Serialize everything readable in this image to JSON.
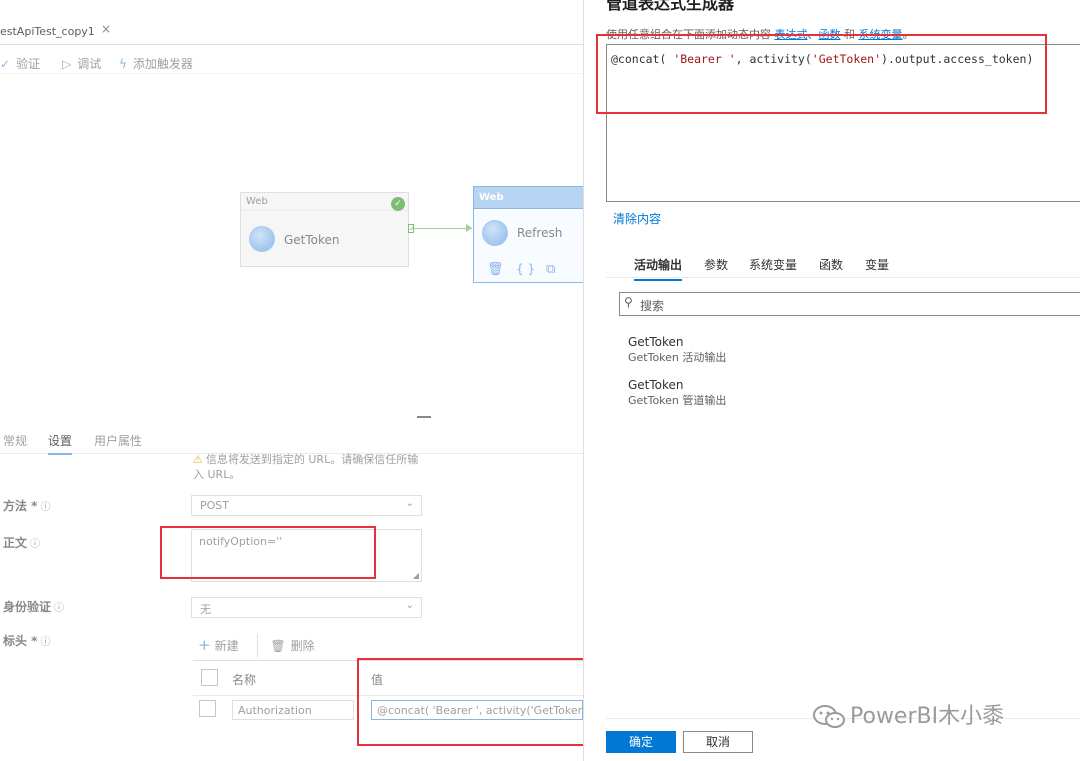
{
  "tab": {
    "title": "estApiTest_copy1",
    "close": "×"
  },
  "toolbar": {
    "validate": "验证",
    "debug": "调试",
    "add_trigger": "添加触发器"
  },
  "nodes": [
    {
      "type": "Web",
      "label": "GetToken",
      "status": "success"
    },
    {
      "type": "Web",
      "label": "Refresh",
      "status": "selected"
    }
  ],
  "settings": {
    "tabs": [
      "常规",
      "设置",
      "用户属性"
    ],
    "selected_tab": "设置",
    "warning": "信息将发送到指定的 URL。请确保信任所输入 URL。",
    "method_label": "方法 *",
    "method_value": "POST",
    "body_label": "正文",
    "body_value": "notifyOption=''",
    "auth_label": "身份验证",
    "auth_value": "无",
    "headers_label": "标头 *",
    "new_label": "新建",
    "delete_label": "删除",
    "col_name": "名称",
    "col_value": "值",
    "header_name_value": "Authorization",
    "header_value_value": "@concat( 'Bearer ', activity('GetToken')...."
  },
  "panel": {
    "title": "管道表达式生成器",
    "desc_prefix": "使用任意组合在下面添加动态内容",
    "desc_link1": "表达式",
    "desc_sep": "、",
    "desc_link2": "函数",
    "desc_and": " 和 ",
    "desc_link3": "系统变量",
    "desc_end": "。",
    "expression_parts": {
      "p1": "@concat( ",
      "p2": "'Bearer '",
      "p3": ", activity(",
      "p4": "'GetToken'",
      "p5": ").output.access_token)"
    },
    "clear": "清除内容",
    "tabs": [
      "活动输出",
      "参数",
      "系统变量",
      "函数",
      "变量"
    ],
    "search_placeholder": "搜索",
    "results": [
      {
        "title": "GetToken",
        "subtitle": "GetToken 活动输出"
      },
      {
        "title": "GetToken",
        "subtitle": "GetToken 管道输出"
      }
    ],
    "ok": "确定",
    "cancel": "取消"
  },
  "watermark": "PowerBI木小黍",
  "colors": {
    "accent": "#0078d4",
    "highlight_box": "#e5313b",
    "success": "#7dbd74"
  }
}
